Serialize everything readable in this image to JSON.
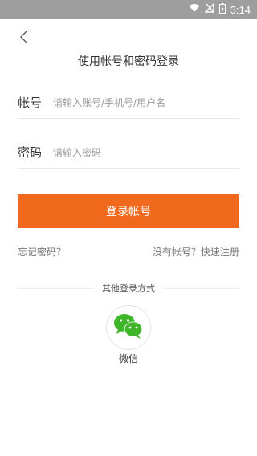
{
  "status_bar": {
    "time": "3:14"
  },
  "header": {
    "title": "使用帐号和密码登录"
  },
  "form": {
    "account_label": "帐号",
    "account_placeholder": "请输入账号/手机号/用户名",
    "password_label": "密码",
    "password_placeholder": "请输入密码"
  },
  "actions": {
    "login_label": "登录帐号",
    "forgot_password": "忘记密码？",
    "register": "没有帐号？快速注册"
  },
  "other_login": {
    "title": "其他登录方式",
    "wechat_label": "微信",
    "wechat_color": "#3fb62a"
  },
  "colors": {
    "primary": "#f0691d",
    "status_bar": "#9e9e9e"
  }
}
